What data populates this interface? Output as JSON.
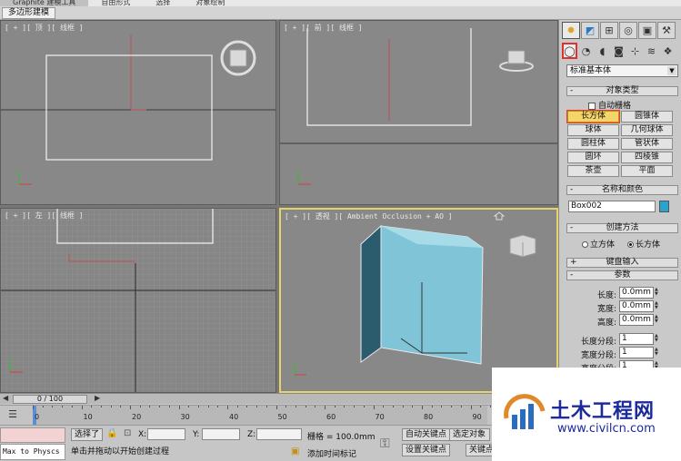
{
  "ribbon": {
    "tabs": [
      "Graphite 建模工具",
      "自由形式",
      "选择",
      "对象绘制"
    ],
    "sub_label": "多边形建模"
  },
  "viewports": {
    "top": "[ + ][ 顶 ][ 线框 ]",
    "front": "[ + ][ 前 ][ 线框 ]",
    "left": "[ + ][ 左 ][ 线框 ]",
    "perspective": "[ + ][ 透视 ][ Ambient Occlusion + AO ]",
    "gizmo_top": "上",
    "gizmo_front": "前",
    "gizmo_persp": "右 前"
  },
  "command_panel": {
    "tab_icons": [
      "create-icon",
      "modify-icon",
      "hierarchy-icon",
      "motion-icon",
      "display-icon",
      "utilities-icon"
    ],
    "category_icons": [
      "geometry-icon",
      "shapes-icon",
      "lights-icon",
      "cameras-icon",
      "helpers-icon",
      "spacewarps-icon",
      "systems-icon"
    ],
    "dropdown": "标准基本体",
    "object_type": {
      "header": "对象类型",
      "autogrid": "自动栅格",
      "buttons": [
        "长方体",
        "圆锥体",
        "球体",
        "几何球体",
        "圆柱体",
        "管状体",
        "圆环",
        "四棱锥",
        "茶壶",
        "平面"
      ]
    },
    "name_color": {
      "header": "名称和颜色",
      "name": "Box002",
      "color": "#2aa3cf"
    },
    "creation_method": {
      "header": "创建方法",
      "options": [
        "立方体",
        "长方体"
      ],
      "selected": "长方体"
    },
    "keyboard_entry": "键盘输入",
    "parameters": {
      "header": "参数",
      "length_label": "长度:",
      "length": "0.0mm",
      "width_label": "宽度:",
      "width": "0.0mm",
      "height_label": "高度:",
      "height": "0.0mm",
      "length_segs_label": "长度分段:",
      "length_segs": "1",
      "width_segs_label": "宽度分段:",
      "width_segs": "1",
      "height_segs_label": "高度分段:",
      "height_segs": "1"
    }
  },
  "timeline": {
    "slider": "0 / 100",
    "ticks": [
      "0",
      "10",
      "20",
      "30",
      "40",
      "50",
      "60",
      "70",
      "80",
      "90"
    ]
  },
  "status": {
    "selected": "选择了",
    "x_label": "X:",
    "y_label": "Y:",
    "z_label": "Z:",
    "grid": "栅格 = 100.0mm",
    "prompt": "单击并拖动以开始创建过程",
    "add_time_tag": "添加时间标记",
    "auto_key": "自动关键点",
    "set_key": "设置关键点",
    "selected_object": "选定对象",
    "key_filters": "关键点",
    "maxscript": "Max to Physcs"
  },
  "watermark": {
    "title": "土木工程网",
    "url": "www.civilcn.com"
  }
}
